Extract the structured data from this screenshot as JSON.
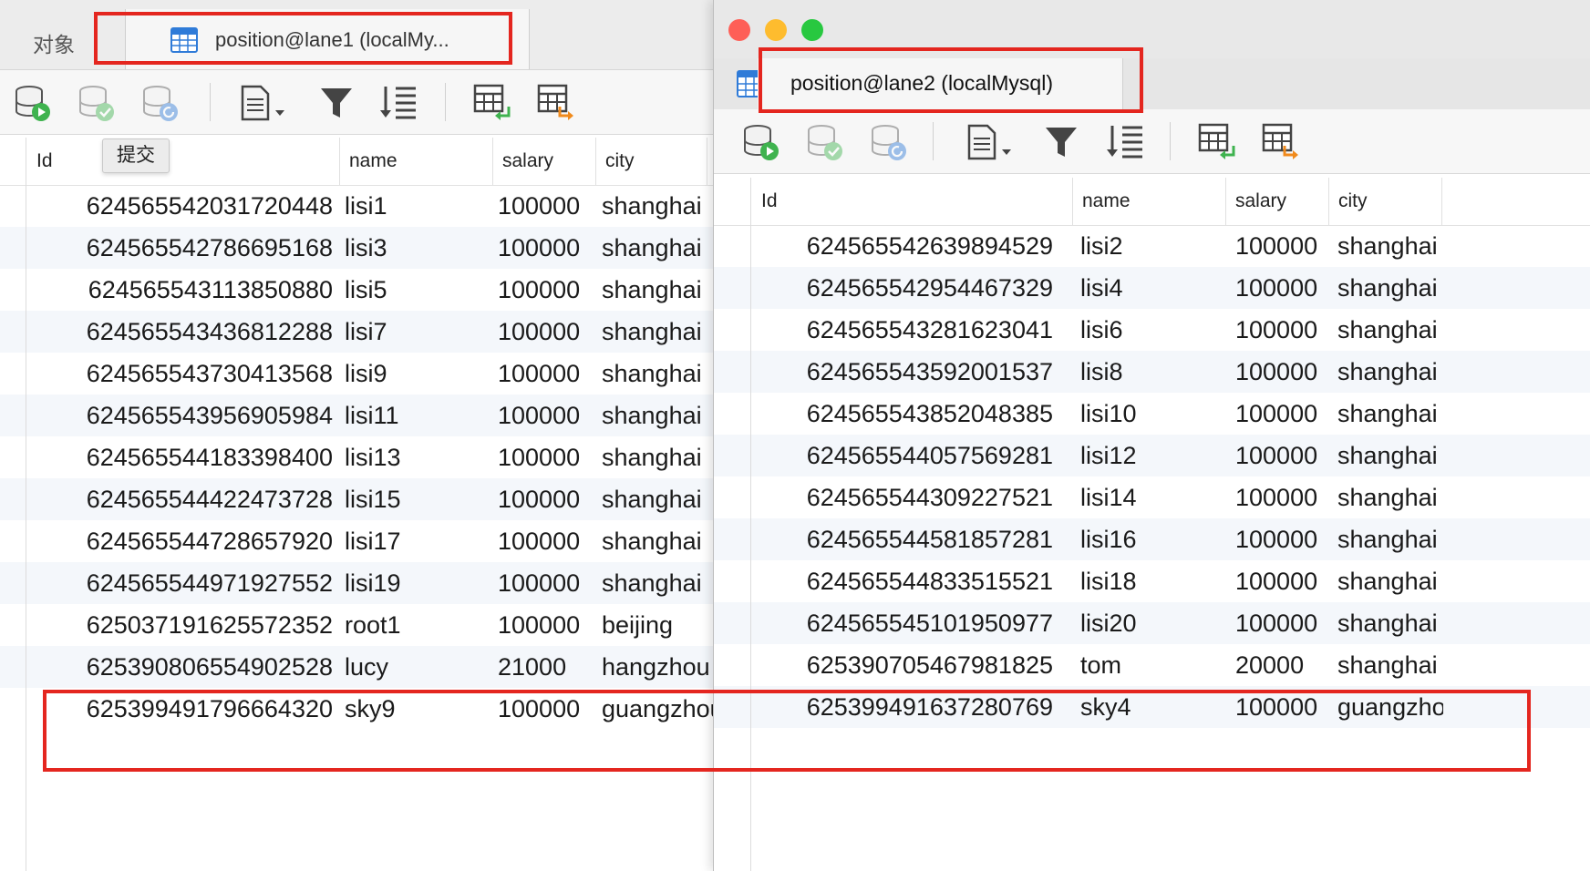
{
  "left": {
    "objects_tab": "对象",
    "active_tab": "position@lane1 (localMy...",
    "tooltip": "提交",
    "columns": [
      "Id",
      "name",
      "salary",
      "city"
    ],
    "rows": [
      [
        "624565542031720448",
        "lisi1",
        "100000",
        "shanghai"
      ],
      [
        "624565542786695168",
        "lisi3",
        "100000",
        "shanghai"
      ],
      [
        "624565543113850880",
        "lisi5",
        "100000",
        "shanghai"
      ],
      [
        "624565543436812288",
        "lisi7",
        "100000",
        "shanghai"
      ],
      [
        "624565543730413568",
        "lisi9",
        "100000",
        "shanghai"
      ],
      [
        "624565543956905984",
        "lisi11",
        "100000",
        "shanghai"
      ],
      [
        "624565544183398400",
        "lisi13",
        "100000",
        "shanghai"
      ],
      [
        "624565544422473728",
        "lisi15",
        "100000",
        "shanghai"
      ],
      [
        "624565544728657920",
        "lisi17",
        "100000",
        "shanghai"
      ],
      [
        "624565544971927552",
        "lisi19",
        "100000",
        "shanghai"
      ],
      [
        "625037191625572352",
        "root1",
        "100000",
        "beijing"
      ],
      [
        "625390806554902528",
        "lucy",
        "21000",
        "hangzhou"
      ],
      [
        "625399491796664320",
        "sky9",
        "100000",
        "guangzhou"
      ]
    ]
  },
  "right": {
    "active_tab": "position@lane2 (localMysql)",
    "columns": [
      "Id",
      "name",
      "salary",
      "city"
    ],
    "rows": [
      [
        "624565542639894529",
        "lisi2",
        "100000",
        "shanghai"
      ],
      [
        "624565542954467329",
        "lisi4",
        "100000",
        "shanghai"
      ],
      [
        "624565543281623041",
        "lisi6",
        "100000",
        "shanghai"
      ],
      [
        "624565543592001537",
        "lisi8",
        "100000",
        "shanghai"
      ],
      [
        "624565543852048385",
        "lisi10",
        "100000",
        "shanghai"
      ],
      [
        "624565544057569281",
        "lisi12",
        "100000",
        "shanghai"
      ],
      [
        "624565544309227521",
        "lisi14",
        "100000",
        "shanghai"
      ],
      [
        "624565544581857281",
        "lisi16",
        "100000",
        "shanghai"
      ],
      [
        "624565544833515521",
        "lisi18",
        "100000",
        "shanghai"
      ],
      [
        "624565545101950977",
        "lisi20",
        "100000",
        "shanghai"
      ],
      [
        "625390705467981825",
        "tom",
        "20000",
        "shanghai"
      ],
      [
        "625399491637280769",
        "sky4",
        "100000",
        "guangzhou"
      ]
    ]
  },
  "icons": {
    "toolbar": [
      "db-run-icon",
      "db-commit-icon",
      "db-rollback-icon",
      "text-view-icon",
      "filter-icon",
      "sort-icon",
      "import-icon",
      "export-icon"
    ]
  },
  "colors": {
    "highlight": "#e4261f",
    "traffic_close": "#fe5f57",
    "traffic_min": "#febc2e",
    "traffic_max": "#28c840"
  }
}
